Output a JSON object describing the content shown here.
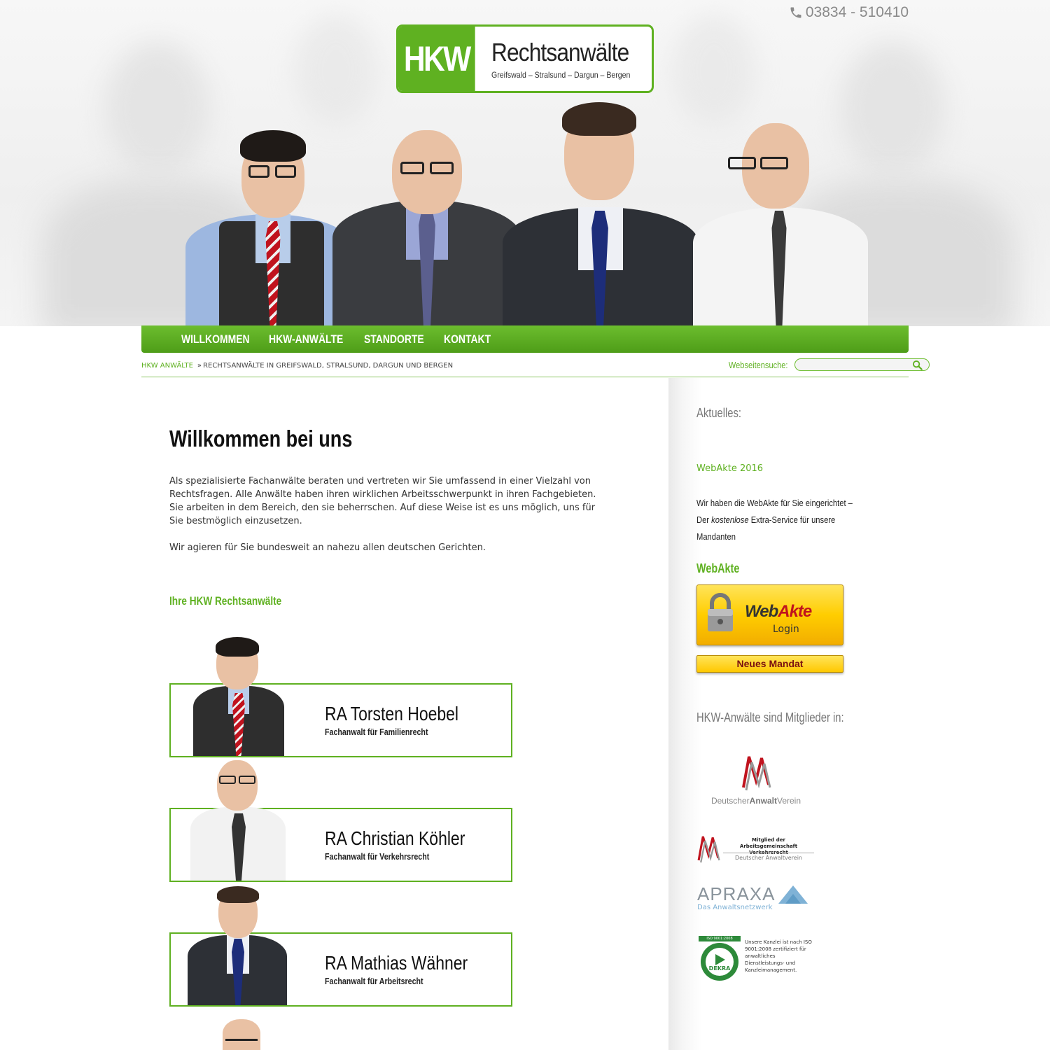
{
  "header": {
    "phone": "03834 - 510410",
    "logo_mark": "HKW",
    "logo_title": "Rechtsanwälte",
    "logo_subtitle": "Greifswald – Stralsund – Dargun – Bergen"
  },
  "nav": {
    "items": [
      {
        "label": "WILLKOMMEN"
      },
      {
        "label": "HKW-ANWÄLTE"
      },
      {
        "label": "STANDORTE"
      },
      {
        "label": "KONTAKT"
      }
    ]
  },
  "breadcrumb": {
    "home": "HKW ANWÄLTE",
    "separator": "»",
    "current": "RECHTSANWÄLTE IN GREIFSWALD, STRALSUND, DARGUN UND BERGEN"
  },
  "search": {
    "label": "Webseitensuche:",
    "placeholder": "",
    "icon": "search-icon"
  },
  "main": {
    "title": "Willkommen bei uns",
    "paragraphs": [
      "Als spezialisierte Fachanwälte beraten und vertreten wir Sie umfassend in einer Vielzahl von Rechtsfragen. Alle Anwälte haben ihren wirklichen Arbeitsschwerpunkt in ihren Fachgebieten. Sie arbeiten in dem Bereich, den sie beherrschen. Auf diese Weise ist es uns möglich, uns für Sie bestmöglich einzusetzen.",
      "Wir agieren für Sie bundesweit an nahezu allen deutschen Gerichten."
    ],
    "lawyers_heading": "Ihre HKW Rechtsanwälte",
    "lawyers": [
      {
        "name": "RA Torsten Hoebel",
        "specialty": "Fachanwalt für Familienrecht"
      },
      {
        "name": "RA Christian Köhler",
        "specialty": "Fachanwalt für Verkehrsrecht"
      },
      {
        "name": "RA Mathias Wähner",
        "specialty": "Fachanwalt für Arbeitsrecht"
      }
    ]
  },
  "sidebar": {
    "news_heading": "Aktuelles:",
    "news_link": "WebAkte 2016",
    "news_text_before": "Wir haben die WebAkte für Sie eingerichtet – Der",
    "news_text_em": "kostenlose",
    "news_text_after": "Extra-Service für unsere Mandanten",
    "webakte_heading": "WebAkte",
    "webakte_word_a": "Web",
    "webakte_word_b": "Akte",
    "webakte_login": "Login",
    "mandat_button": "Neues Mandat",
    "members_heading": "HKW-Anwälte sind Mitglieder in:",
    "dav_text_a": "Deutscher",
    "dav_text_b": "Anwalt",
    "dav_text_c": "Verein",
    "arge_text": "Mitglied der Arbeitsgemeinschaft Verkehrsrecht",
    "arge_sub": "Deutscher Anwaltverein",
    "apraxa_word": "APRAXA",
    "apraxa_sub": "Das Anwaltsnetzwerk",
    "dekra_iso": "ISO 9001:2008",
    "dekra_brand": "DEKRA",
    "dekra_text": "Unsere Kanzlei ist nach ISO 9001:2008 zertifiziert für anwaltliches Dienstleistungs- und Kanzleimanagement."
  },
  "colors": {
    "brand_green": "#5fb121",
    "accent_yellow": "#ffcd00",
    "accent_red": "#c0131e"
  }
}
